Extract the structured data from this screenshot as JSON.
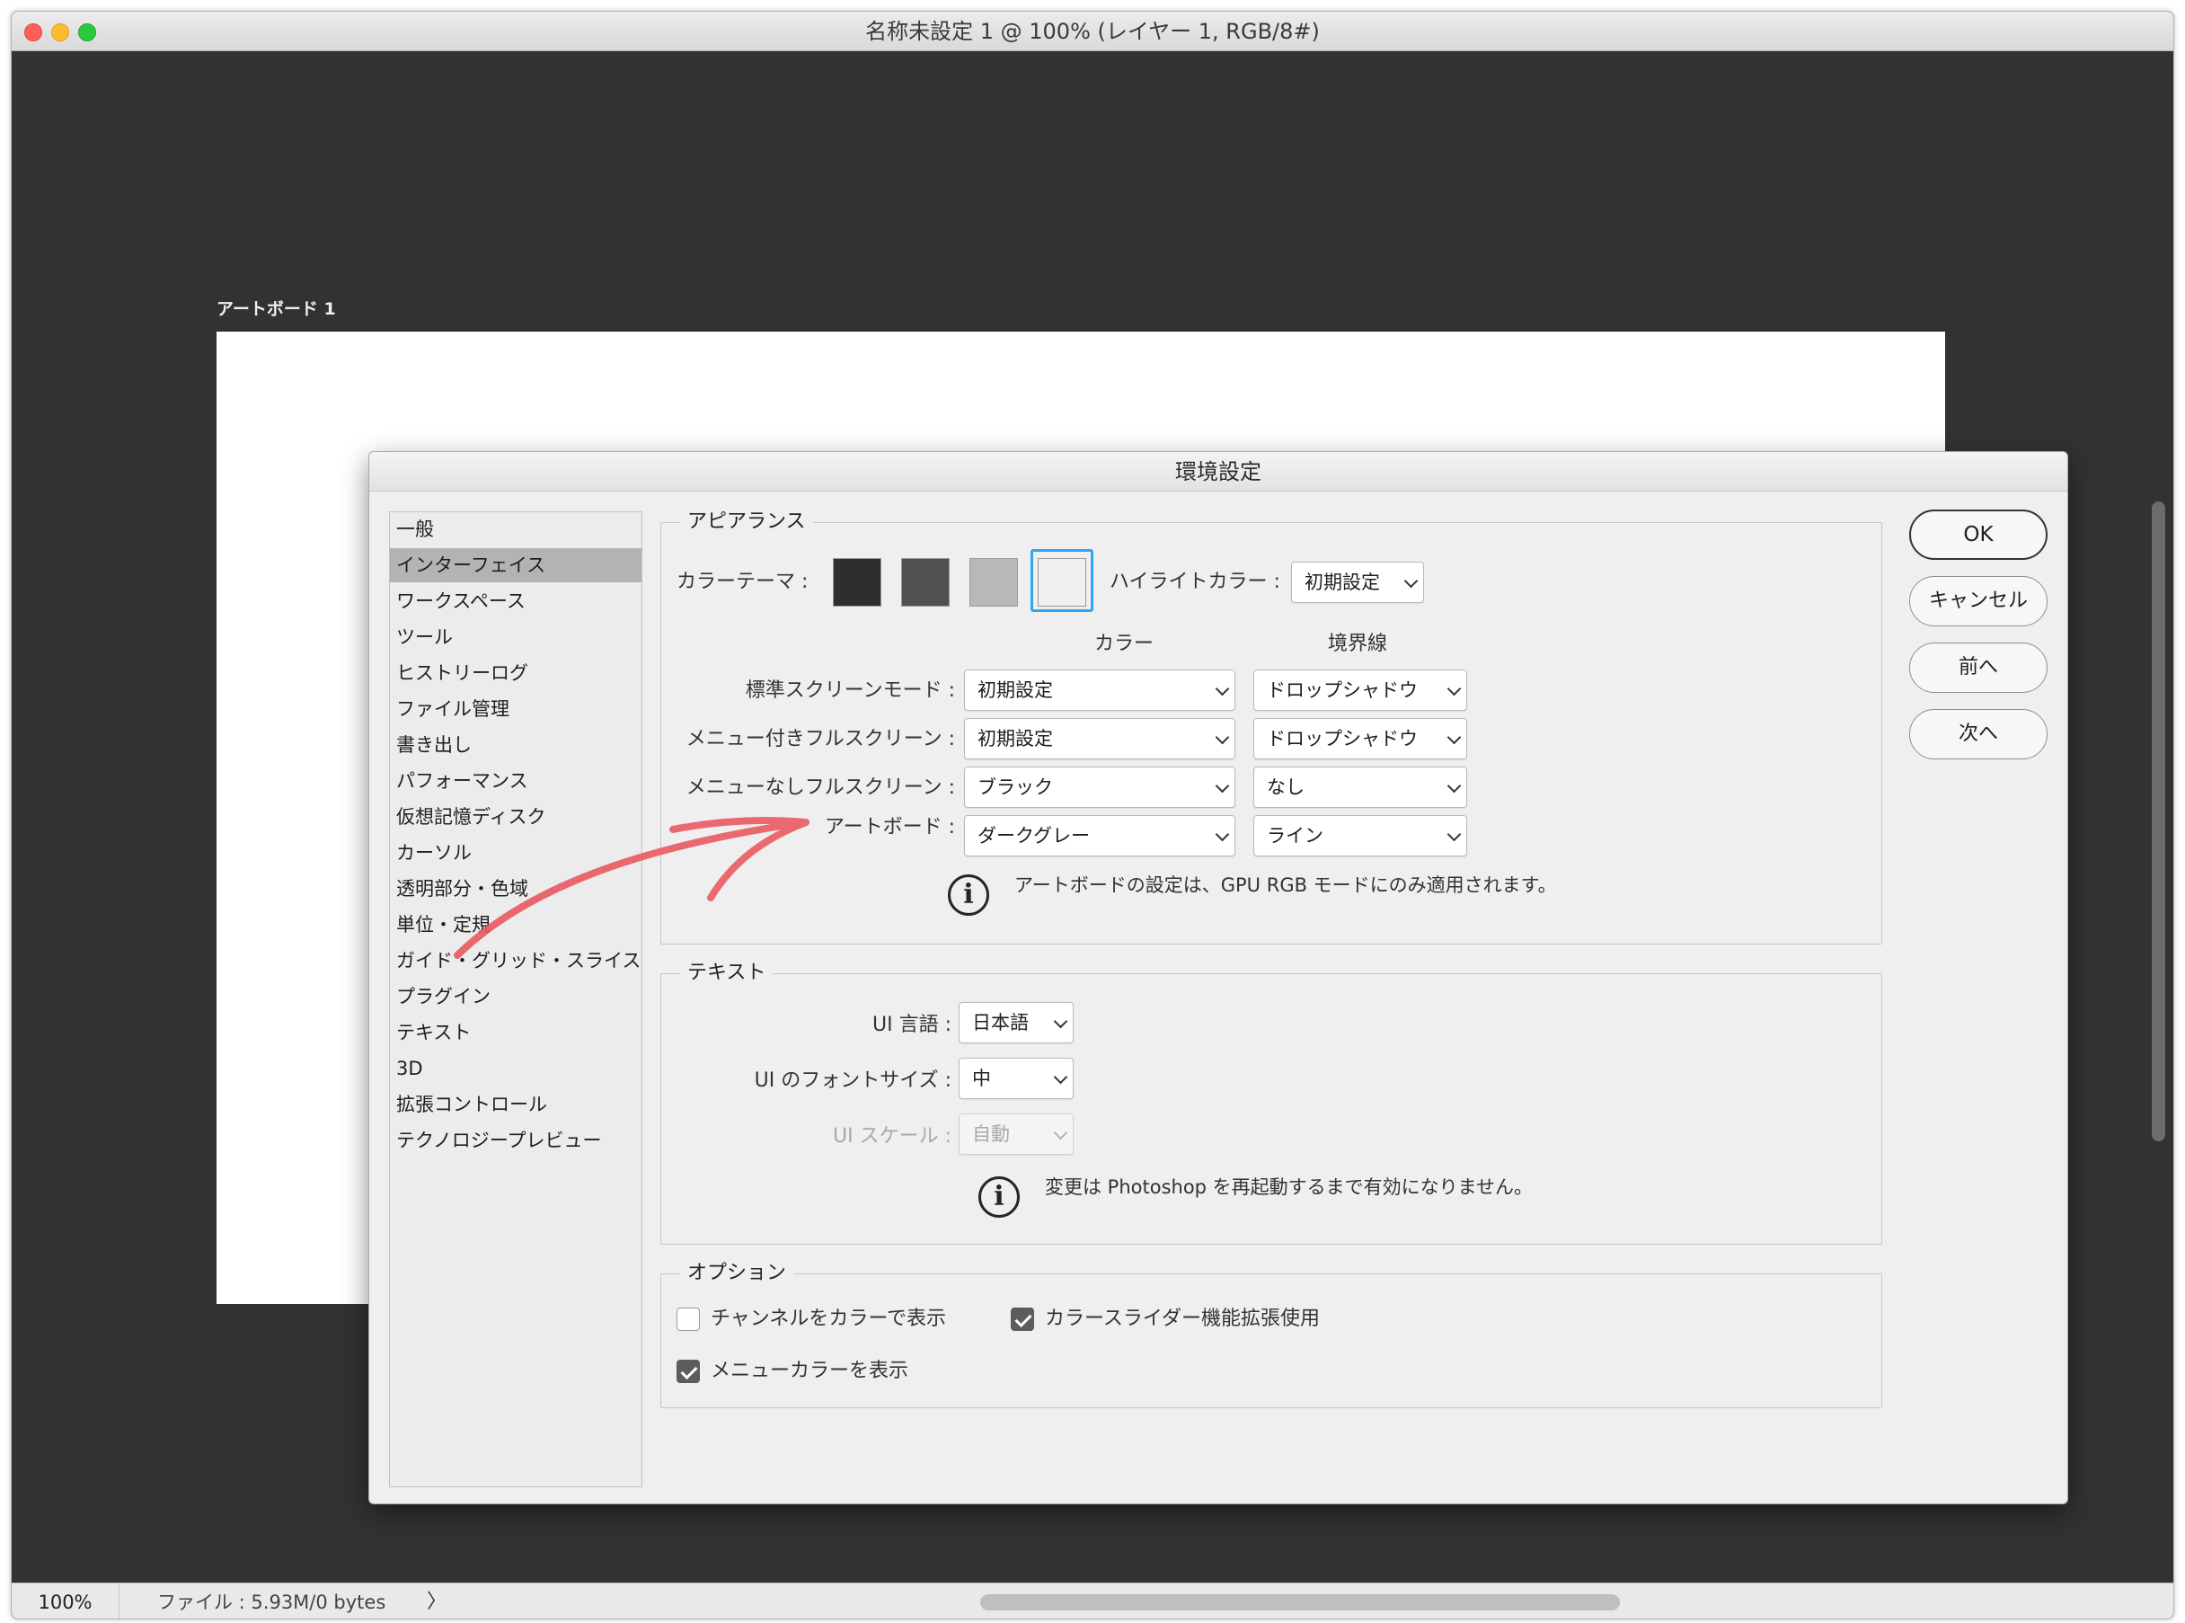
{
  "window": {
    "title": "名称未設定 1 @ 100% (レイヤー 1, RGB/8#)"
  },
  "canvas": {
    "artboard_label": "アートボード 1"
  },
  "statusbar": {
    "zoom": "100%",
    "file_info": "ファイル : 5.93M/0 bytes",
    "arrow": "〉"
  },
  "dialog": {
    "title": "環境設定",
    "nav": [
      {
        "label": "一般"
      },
      {
        "label": "インターフェイス",
        "selected": true
      },
      {
        "label": "ワークスペース"
      },
      {
        "label": "ツール"
      },
      {
        "label": "ヒストリーログ"
      },
      {
        "label": "ファイル管理"
      },
      {
        "label": "書き出し"
      },
      {
        "label": "パフォーマンス"
      },
      {
        "label": "仮想記憶ディスク"
      },
      {
        "label": "カーソル"
      },
      {
        "label": "透明部分・色域"
      },
      {
        "label": "単位・定規"
      },
      {
        "label": "ガイド・グリッド・スライス"
      },
      {
        "label": "プラグイン"
      },
      {
        "label": "テキスト"
      },
      {
        "label": "3D"
      },
      {
        "label": "拡張コントロール"
      },
      {
        "label": "テクノロジープレビュー"
      }
    ],
    "appearance": {
      "legend": "アピアランス",
      "color_theme_label": "カラーテーマ :",
      "theme_swatches": [
        "#2e2e2e",
        "#505050",
        "#b8b8b8",
        "#f0f0f0"
      ],
      "selected_theme": 4,
      "highlight_label": "ハイライトカラー :",
      "highlight_value": "初期設定",
      "col_color": "カラー",
      "col_border": "境界線",
      "rows": [
        {
          "label": "標準スクリーンモード :",
          "color": "初期設定",
          "border": "ドロップシャドウ"
        },
        {
          "label": "メニュー付きフルスクリーン :",
          "color": "初期設定",
          "border": "ドロップシャドウ"
        },
        {
          "label": "メニューなしフルスクリーン :",
          "color": "ブラック",
          "border": "なし"
        },
        {
          "label": "アートボード :",
          "color": "ダークグレー",
          "border": "ライン"
        }
      ],
      "note": "アートボードの設定は、GPU RGB モードにのみ適用されます。"
    },
    "text_group": {
      "legend": "テキスト",
      "ui_language_label": "UI 言語 :",
      "ui_language_value": "日本語",
      "ui_font_size_label": "UI のフォントサイズ :",
      "ui_font_size_value": "中",
      "ui_scale_label": "UI スケール :",
      "ui_scale_value": "自動",
      "note": "変更は Photoshop を再起動するまで有効になりません。"
    },
    "options": {
      "legend": "オプション",
      "channel_color": {
        "label": "チャンネルをカラーで表示",
        "checked": false
      },
      "color_slider": {
        "label": "カラースライダー機能拡張使用",
        "checked": true
      },
      "menu_color": {
        "label": "メニューカラーを表示",
        "checked": true
      }
    },
    "buttons": {
      "ok": "OK",
      "cancel": "キャンセル",
      "prev": "前へ",
      "next": "次へ"
    },
    "info_glyph": "i"
  },
  "annotation_arrow_color": "#e85a60"
}
